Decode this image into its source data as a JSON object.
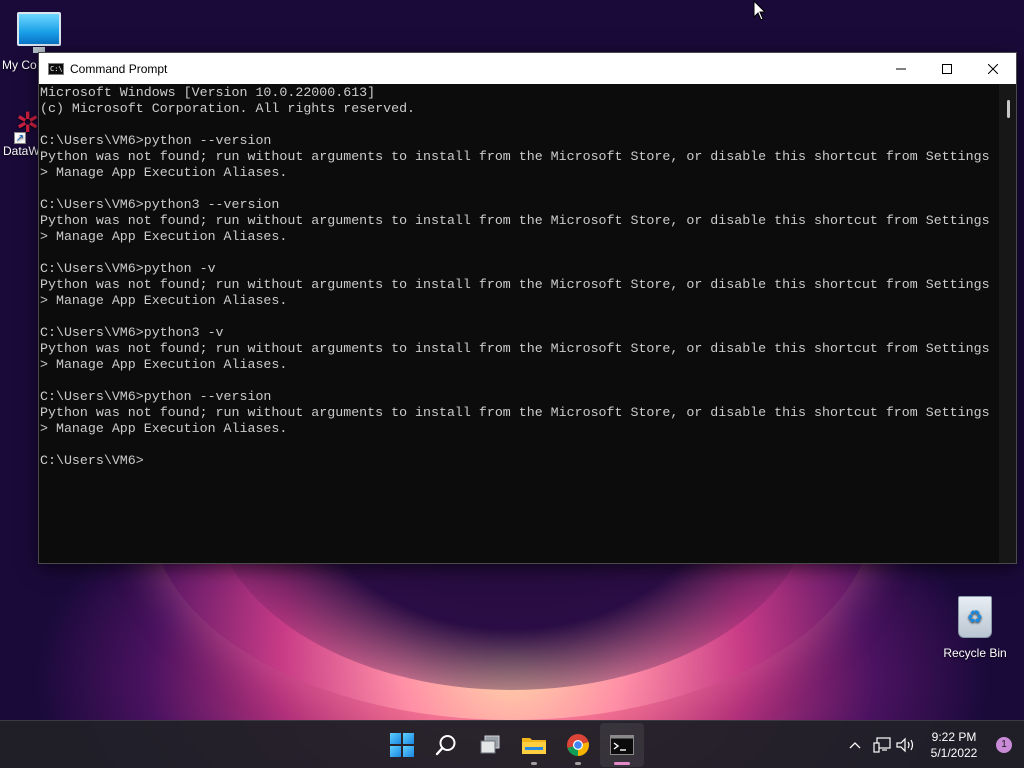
{
  "desktop": {
    "icons": [
      {
        "label": "My Co"
      },
      {
        "label": "DataW"
      },
      {
        "label": "Recycle Bin"
      }
    ]
  },
  "window": {
    "title": "Command Prompt",
    "console_text": "Microsoft Windows [Version 10.0.22000.613]\n(c) Microsoft Corporation. All rights reserved.\n\nC:\\Users\\VM6>python --version\nPython was not found; run without arguments to install from the Microsoft Store, or disable this shortcut from Settings\n> Manage App Execution Aliases.\n\nC:\\Users\\VM6>python3 --version\nPython was not found; run without arguments to install from the Microsoft Store, or disable this shortcut from Settings\n> Manage App Execution Aliases.\n\nC:\\Users\\VM6>python -v\nPython was not found; run without arguments to install from the Microsoft Store, or disable this shortcut from Settings\n> Manage App Execution Aliases.\n\nC:\\Users\\VM6>python3 -v\nPython was not found; run without arguments to install from the Microsoft Store, or disable this shortcut from Settings\n> Manage App Execution Aliases.\n\nC:\\Users\\VM6>python --version\nPython was not found; run without arguments to install from the Microsoft Store, or disable this shortcut from Settings\n> Manage App Execution Aliases.\n\nC:\\Users\\VM6>",
    "controls": {
      "minimize": "minimize-icon",
      "maximize": "maximize-icon",
      "close": "close-icon"
    }
  },
  "taskbar": {
    "apps": [
      "start-icon",
      "search-icon",
      "task-view-icon",
      "file-explorer-icon",
      "chrome-icon",
      "command-prompt-icon"
    ],
    "tray": {
      "time": "9:22 PM",
      "date": "5/1/2022",
      "notification_count": "1"
    }
  },
  "colors": {
    "console_bg": "#0c0c0c",
    "console_fg": "#cccccc",
    "taskbar_bg": "#202028",
    "accent": "#1a86e0"
  }
}
